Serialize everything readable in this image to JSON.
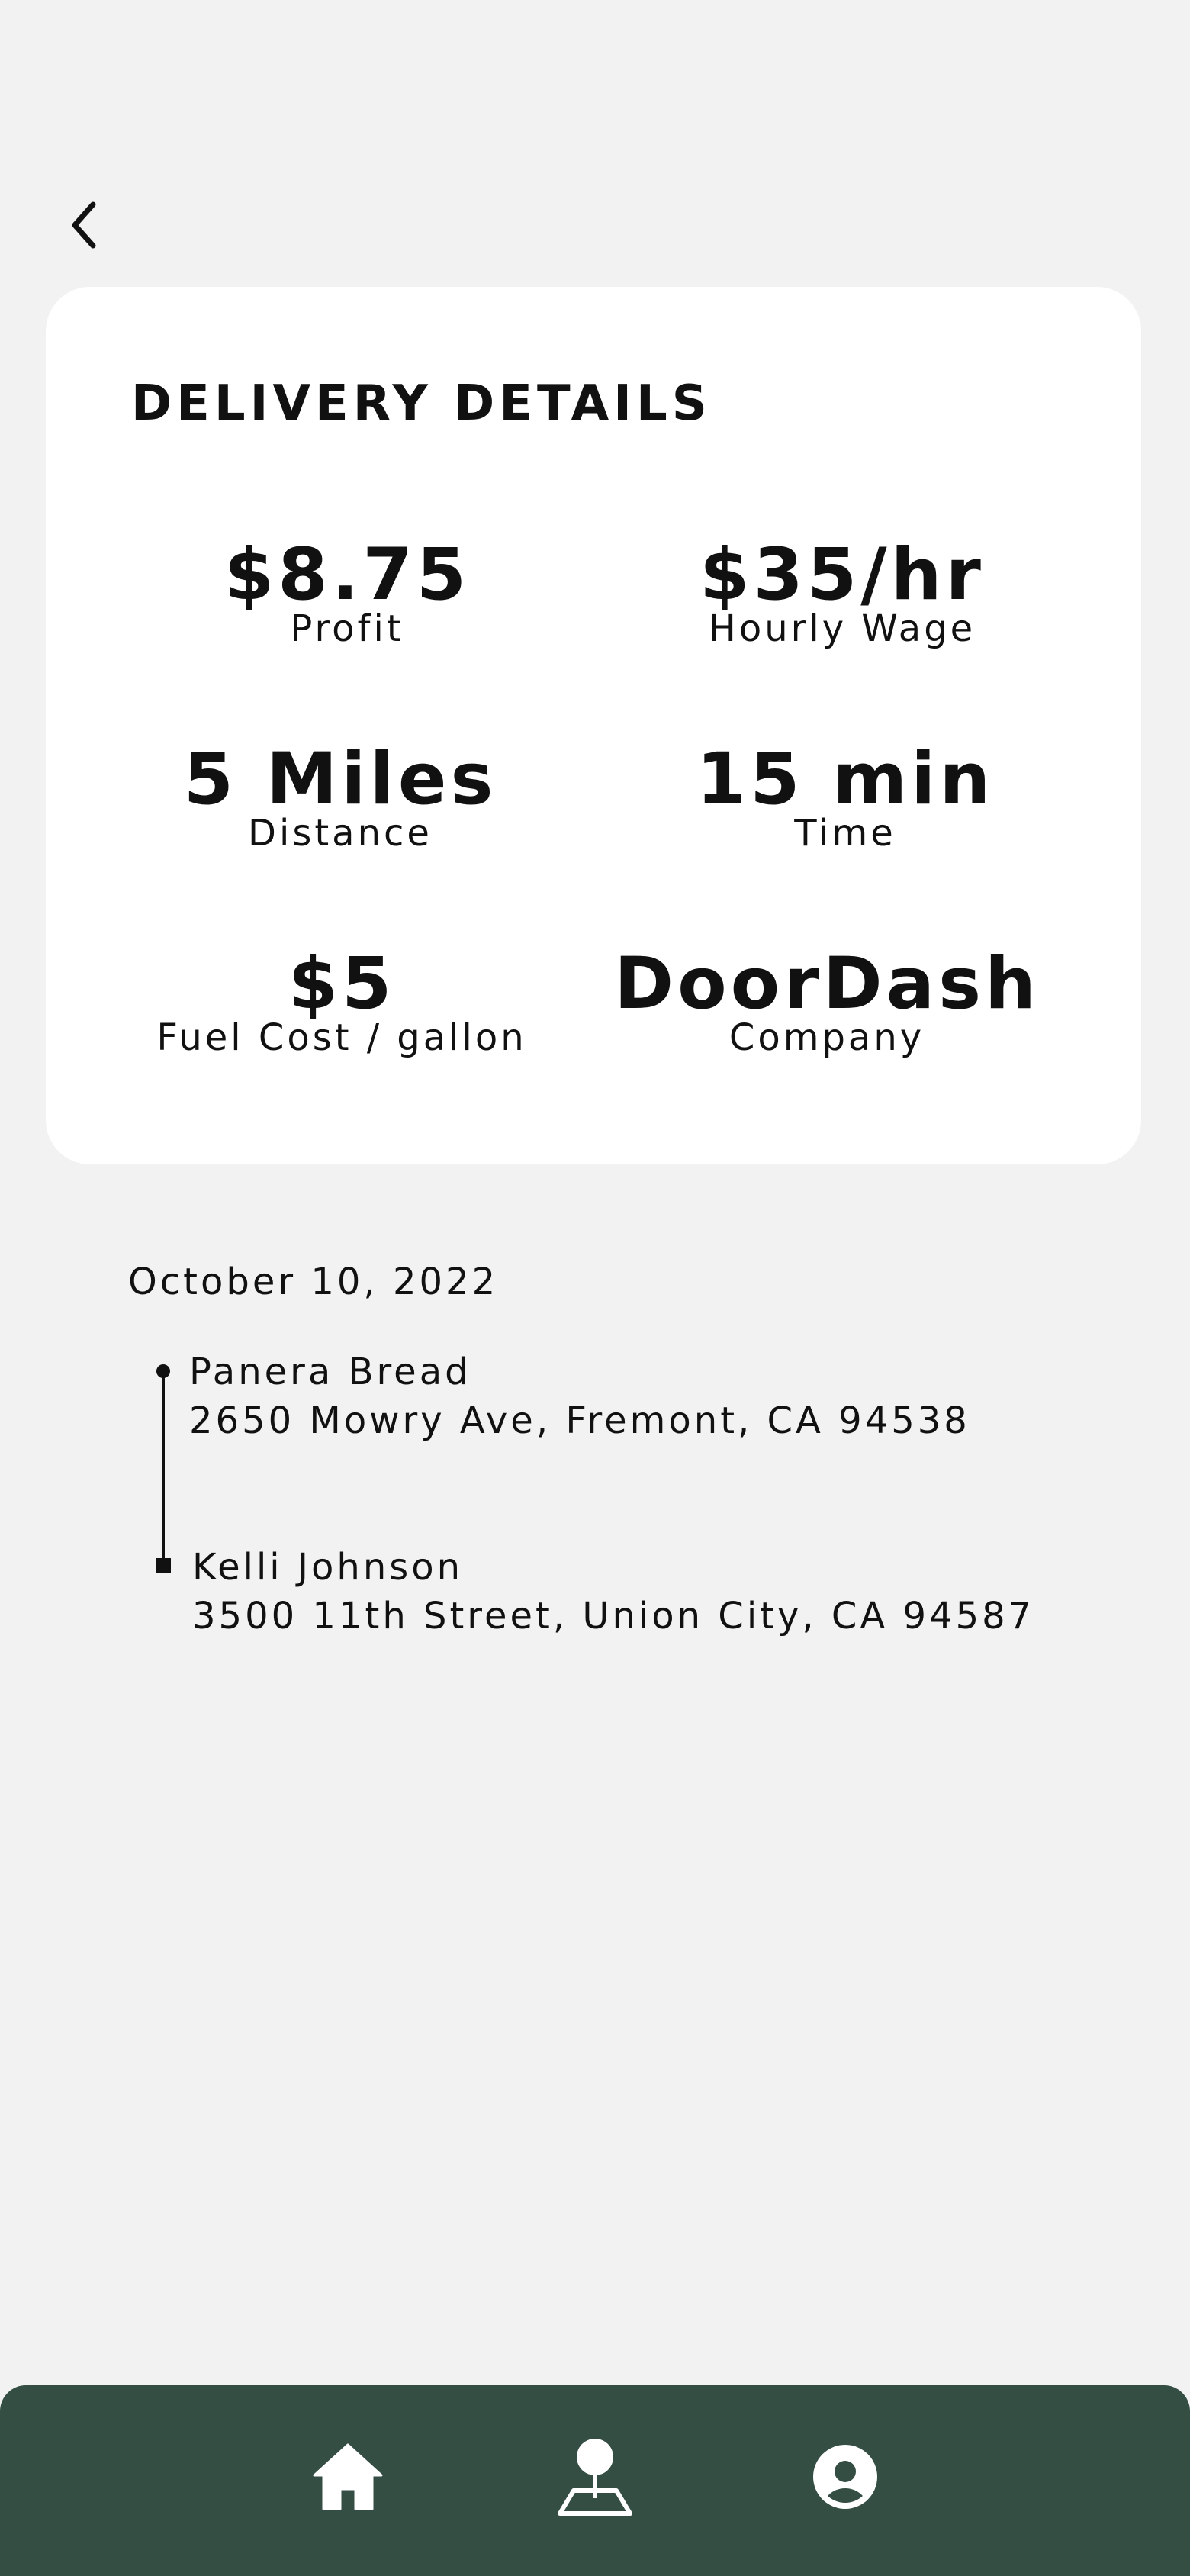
{
  "header": {
    "back_icon": "chevron-left-icon"
  },
  "card": {
    "title": "DELIVERY DETAILS",
    "stats": {
      "profit": {
        "value": "$8.75",
        "label": "Profit"
      },
      "hourly_wage": {
        "value": "$35/hr",
        "label": "Hourly Wage"
      },
      "distance": {
        "value": "5 Miles",
        "label": "Distance"
      },
      "time": {
        "value": "15 min",
        "label": "Time"
      },
      "fuel_cost": {
        "value": "$5",
        "label": "Fuel Cost / gallon"
      },
      "company": {
        "value": "DoorDash",
        "label": "Company"
      }
    }
  },
  "trip": {
    "date": "October 10, 2022",
    "pickup": {
      "name": "Panera Bread",
      "address": "2650 Mowry Ave, Fremont, CA 94538"
    },
    "dropoff": {
      "name": "Kelli Johnson",
      "address": "3500 11th Street, Union City, CA 94587"
    }
  },
  "bottom_nav": {
    "items": [
      {
        "icon": "home-icon"
      },
      {
        "icon": "map-pin-icon"
      },
      {
        "icon": "user-profile-icon"
      }
    ]
  },
  "colors": {
    "background": "#f2f2f2",
    "card": "#ffffff",
    "nav_bar": "#344e43",
    "text": "#111111"
  }
}
